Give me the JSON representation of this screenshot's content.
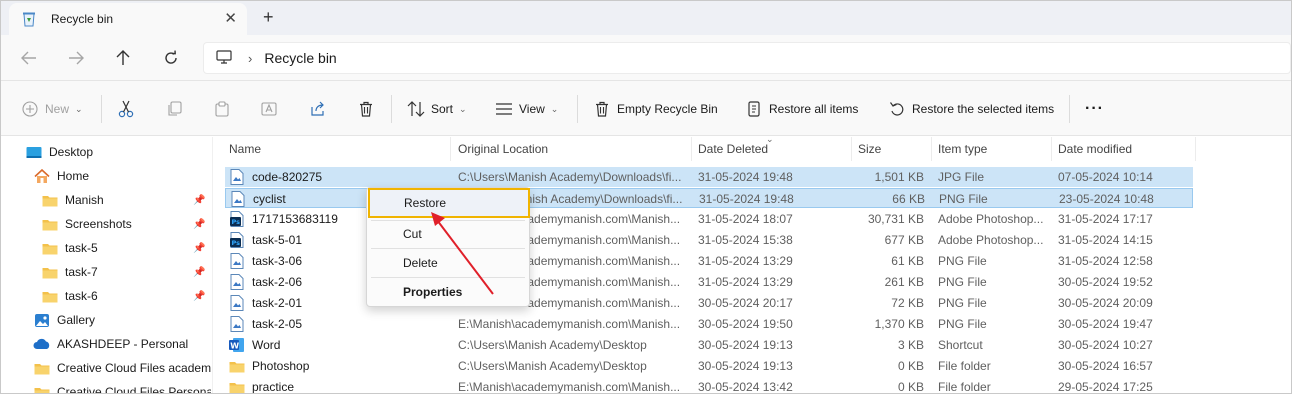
{
  "window": {
    "tab_title": "Recycle bin",
    "tab_close": "✕",
    "new_tab": "+"
  },
  "address": {
    "location": "Recycle bin"
  },
  "toolbar": {
    "new_label": "New",
    "sort_label": "Sort",
    "view_label": "View",
    "empty_label": "Empty Recycle Bin",
    "restore_all_label": "Restore all items",
    "restore_selected_label": "Restore the selected items",
    "more_label": "···"
  },
  "sidebar": {
    "items": [
      {
        "label": "Desktop",
        "icon": "desktop-icon"
      },
      {
        "label": "Home",
        "icon": "home-icon"
      },
      {
        "label": "Manish",
        "icon": "folder-icon",
        "pinned": true
      },
      {
        "label": "Screenshots",
        "icon": "folder-icon",
        "pinned": true
      },
      {
        "label": "task-5",
        "icon": "folder-icon",
        "pinned": true
      },
      {
        "label": "task-7",
        "icon": "folder-icon",
        "pinned": true
      },
      {
        "label": "task-6",
        "icon": "folder-icon",
        "pinned": true
      },
      {
        "label": "Gallery",
        "icon": "gallery-icon"
      },
      {
        "label": "AKASHDEEP - Personal",
        "icon": "cloud-icon"
      },
      {
        "label": "Creative Cloud Files  academ",
        "icon": "folder-icon"
      },
      {
        "label": "Creative Cloud Files Personal",
        "icon": "folder-icon"
      }
    ]
  },
  "columns": {
    "name": "Name",
    "original_location": "Original Location",
    "date_deleted": "Date Deleted",
    "size": "Size",
    "item_type": "Item type",
    "date_modified": "Date modified"
  },
  "files": [
    {
      "name": "code-820275",
      "location": "C:\\Users\\Manish Academy\\Downloads\\fi...",
      "deleted": "31-05-2024 19:48",
      "size": "1,501 KB",
      "type": "JPG File",
      "modified": "07-05-2024 10:14",
      "icon": "image-file-icon",
      "selected": true
    },
    {
      "name": "cyclist",
      "location": "C:\\Users\\Manish Academy\\Downloads\\fi...",
      "deleted": "31-05-2024 19:48",
      "size": "66 KB",
      "type": "PNG File",
      "modified": "23-05-2024 10:48",
      "icon": "image-file-icon",
      "selected": true
    },
    {
      "name": "1717153683119",
      "location": "E:\\Manish\\academymanish.com\\Manish...",
      "deleted": "31-05-2024 18:07",
      "size": "30,731 KB",
      "type": "Adobe Photoshop...",
      "modified": "31-05-2024 17:17",
      "icon": "photoshop-file-icon"
    },
    {
      "name": "task-5-01",
      "location": "E:\\Manish\\academymanish.com\\Manish...",
      "deleted": "31-05-2024 15:38",
      "size": "677 KB",
      "type": "Adobe Photoshop...",
      "modified": "31-05-2024 14:15",
      "icon": "photoshop-file-icon"
    },
    {
      "name": "task-3-06",
      "location": "E:\\Manish\\academymanish.com\\Manish...",
      "deleted": "31-05-2024 13:29",
      "size": "61 KB",
      "type": "PNG File",
      "modified": "31-05-2024 12:58",
      "icon": "image-file-icon"
    },
    {
      "name": "task-2-06",
      "location": "E:\\Manish\\academymanish.com\\Manish...",
      "deleted": "31-05-2024 13:29",
      "size": "261 KB",
      "type": "PNG File",
      "modified": "30-05-2024 19:52",
      "icon": "image-file-icon"
    },
    {
      "name": "task-2-01",
      "location": "E:\\Manish\\academymanish.com\\Manish...",
      "deleted": "30-05-2024 20:17",
      "size": "72 KB",
      "type": "PNG File",
      "modified": "30-05-2024 20:09",
      "icon": "image-file-icon"
    },
    {
      "name": "task-2-05",
      "location": "E:\\Manish\\academymanish.com\\Manish...",
      "deleted": "30-05-2024 19:50",
      "size": "1,370 KB",
      "type": "PNG File",
      "modified": "30-05-2024 19:47",
      "icon": "image-file-icon"
    },
    {
      "name": "Word",
      "location": "C:\\Users\\Manish Academy\\Desktop",
      "deleted": "30-05-2024 19:13",
      "size": "3 KB",
      "type": "Shortcut",
      "modified": "30-05-2024 10:27",
      "icon": "word-shortcut-icon"
    },
    {
      "name": "Photoshop",
      "location": "C:\\Users\\Manish Academy\\Desktop",
      "deleted": "30-05-2024 19:13",
      "size": "0 KB",
      "type": "File folder",
      "modified": "30-05-2024 16:57",
      "icon": "folder-icon"
    },
    {
      "name": "practice",
      "location": "E:\\Manish\\academymanish.com\\Manish...",
      "deleted": "30-05-2024 13:42",
      "size": "0 KB",
      "type": "File folder",
      "modified": "29-05-2024 17:25",
      "icon": "folder-icon"
    }
  ],
  "context_menu": {
    "restore": "Restore",
    "cut": "Cut",
    "delete": "Delete",
    "properties": "Properties"
  },
  "colors": {
    "selection": "#cce4f7",
    "highlight_border": "#f0b400",
    "annotation_arrow": "#e0202a",
    "folder": "#f3c14b"
  }
}
